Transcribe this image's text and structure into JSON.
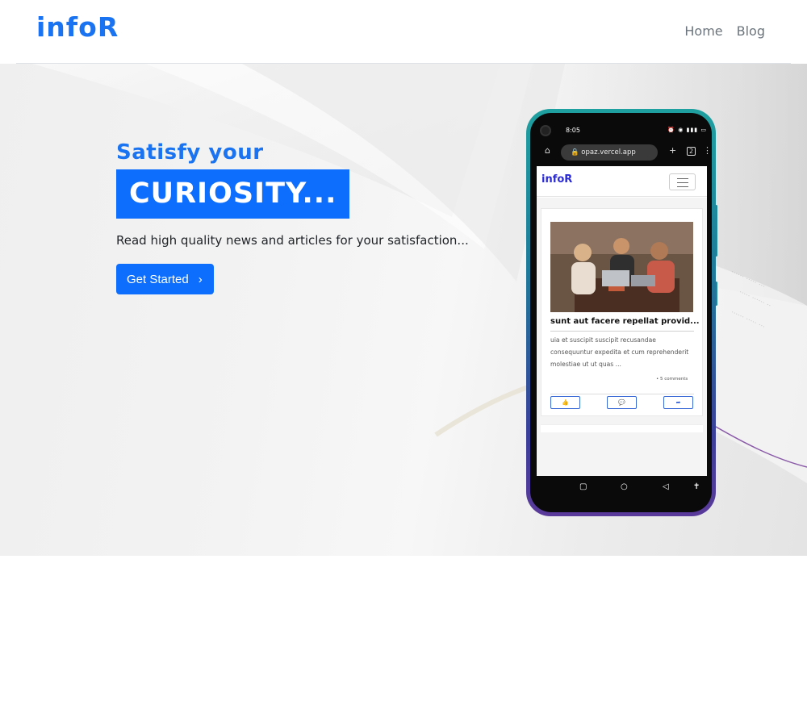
{
  "navbar": {
    "brand": "infoR",
    "links": [
      {
        "label": "Home"
      },
      {
        "label": "Blog"
      }
    ]
  },
  "hero": {
    "subtitle": "Satisfy your",
    "title": "CURIOSITY...",
    "description": "Read high quality news and articles for your satisfaction...",
    "cta_label": "Get Started",
    "cta_icon": "chevron-right-icon"
  },
  "phone": {
    "status_time": "8:05",
    "url": "opaz.vercel.app",
    "tab_count": "2",
    "app": {
      "brand": "infoR",
      "card": {
        "title": "sunt aut facere repellat provid...",
        "body": "uia et suscipit suscipit recusandae consequuntur expedita et cum reprehenderit molestiae ut ut quas ...",
        "comments": "5 comments",
        "actions": [
          "like-icon",
          "comment-icon",
          "share-icon"
        ]
      }
    }
  },
  "colors": {
    "primary": "#0d6efd",
    "brand": "#1a73f0",
    "muted_link": "#6c757d"
  }
}
